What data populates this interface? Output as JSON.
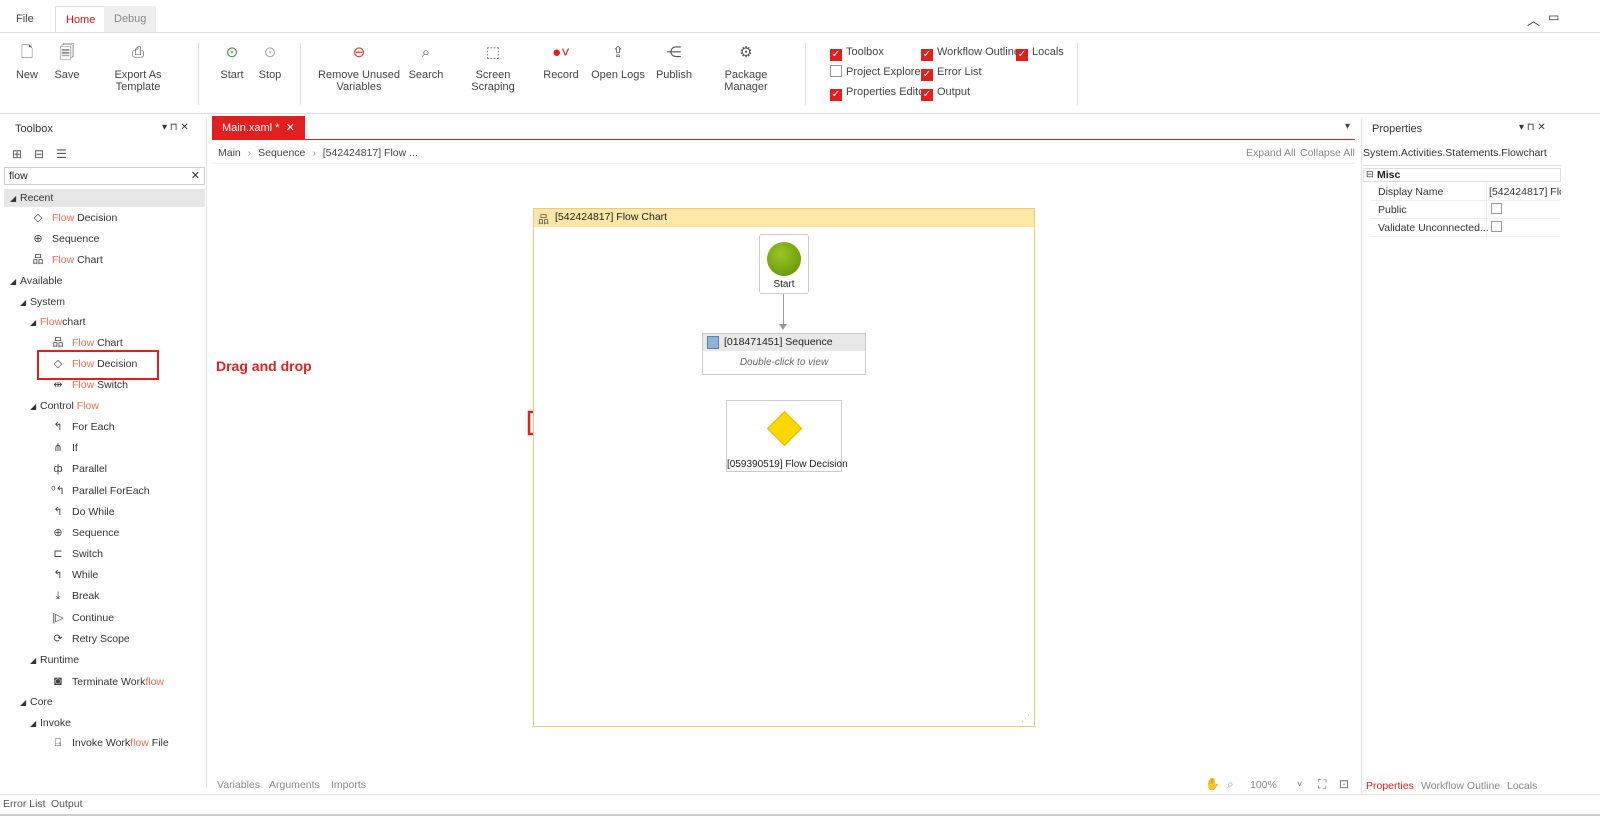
{
  "ribbon_tabs": {
    "file": "File",
    "home": "Home",
    "debug": "Debug"
  },
  "ribbon": {
    "new": "New",
    "save": "Save",
    "export": "Export As Template",
    "start": "Start",
    "stop": "Stop",
    "remove_unused_1": "Remove Unused",
    "remove_unused_2": "Variables",
    "search": "Search",
    "screen_scraping": "Screen Scraping",
    "record": "Record",
    "open_logs": "Open Logs",
    "publish": "Publish",
    "package_manager": "Package Manager"
  },
  "panels_toggles": [
    {
      "label": "Toolbox",
      "checked": true
    },
    {
      "label": "Project Explorer",
      "checked": false
    },
    {
      "label": "Properties Editor",
      "checked": true
    },
    {
      "label": "Workflow Outline",
      "checked": true
    },
    {
      "label": "Error List",
      "checked": true
    },
    {
      "label": "Output",
      "checked": true
    },
    {
      "label": "Locals",
      "checked": true
    }
  ],
  "toolbox": {
    "title": "Toolbox",
    "search_value": "flow",
    "recent": "Recent",
    "recent_items": [
      {
        "pre": "",
        "hl": "Flow",
        "post": " Decision"
      },
      {
        "pre": "Sequence",
        "hl": "",
        "post": ""
      },
      {
        "pre": "",
        "hl": "Flow",
        "post": " Chart"
      }
    ],
    "available": "Available",
    "system": "System",
    "flowchart_hl": "Flow",
    "flowchart_post": "chart",
    "flowchart_items": [
      {
        "hl": "Flow",
        "post": " Chart"
      },
      {
        "hl": "Flow",
        "post": " Decision"
      },
      {
        "hl": "Flow",
        "post": " Switch"
      }
    ],
    "control_pre": "Control ",
    "control_hl": "Flow",
    "control_items": [
      "For Each",
      "If",
      "Parallel",
      "Parallel ForEach",
      "Do While",
      "Sequence",
      "Switch",
      "While",
      "Break",
      "Continue",
      "Retry Scope"
    ],
    "runtime": "Runtime",
    "terminate_pre": "Terminate Work",
    "terminate_hl": "flow",
    "core": "Core",
    "invoke": "Invoke",
    "invoke_pre": "Invoke Work",
    "invoke_hl": "flow",
    "invoke_post": " File"
  },
  "annotation": {
    "drag_drop": "Drag and drop"
  },
  "document": {
    "tab": "Main.xaml *",
    "breadcrumb": [
      "Main",
      "Sequence",
      "[542424817] Flow ..."
    ],
    "expand_all": "Expand All",
    "collapse_all": "Collapse All",
    "flowchart_title": "[542424817] Flow Chart",
    "start_label": "Start",
    "sequence_title": "[018471451] Sequence",
    "sequence_hint": "Double-click to view",
    "decision_label": "[059390519] Flow Decision",
    "bottom_tabs": [
      "Variables",
      "Arguments",
      "Imports"
    ],
    "zoom": "100%"
  },
  "properties": {
    "title": "Properties",
    "type": "System.Activities.Statements.Flowchart",
    "category": "Misc",
    "rows": [
      {
        "name": "Display Name",
        "value": "[542424817] Flo"
      },
      {
        "name": "Public",
        "value": ""
      },
      {
        "name": "Validate Unconnected...",
        "value": ""
      }
    ],
    "bottom_tabs": [
      "Properties",
      "Workflow Outline",
      "Locals"
    ]
  },
  "status_tabs": [
    "Error List",
    "Output"
  ],
  "colors": {
    "accent": "#e0201f",
    "start_green": "#6a9a0a",
    "decision_yellow": "#ffd800",
    "header_yellow": "#fde7a6"
  }
}
